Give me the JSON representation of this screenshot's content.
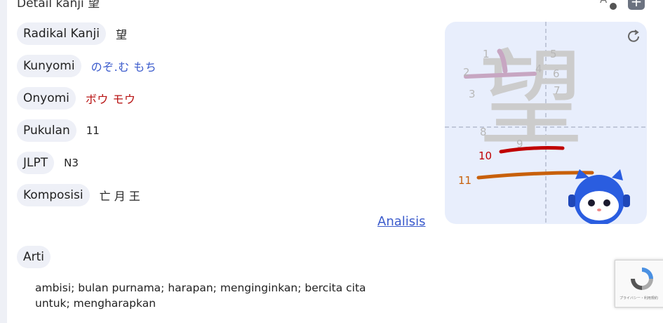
{
  "section": {
    "title": "Detail kanji 望"
  },
  "fields": {
    "radikal": {
      "label": "Radikal Kanji",
      "value": "望"
    },
    "kunyomi": {
      "label": "Kunyomi",
      "value": "のぞ.む  もち"
    },
    "onyomi": {
      "label": "Onyomi",
      "value": "ボウ  モウ"
    },
    "pukulan": {
      "label": "Pukulan",
      "value": "11"
    },
    "jlpt": {
      "label": "JLPT",
      "value": "N3"
    },
    "komposisi": {
      "label": "Komposisi",
      "value": "亡 月 王"
    }
  },
  "analysis_link": "Analisis",
  "meaning": {
    "label": "Arti",
    "text": "ambisi; bulan purnama; harapan; menginginkan; bercita cita untuk; mengharapkan"
  },
  "stroke_order": {
    "character": "望",
    "numbers": [
      "1",
      "2",
      "3",
      "4",
      "5",
      "6",
      "7",
      "8",
      "9",
      "10",
      "11"
    ],
    "colors": {
      "stroke_10": "#c00000",
      "stroke_11": "#c8600a",
      "ghost": "#c8c8c8",
      "done_stroke": "#c8a8c0"
    }
  },
  "recaptcha": {
    "text": "プライバシー・利用規約"
  },
  "icons": {
    "translate": "translate-icon",
    "add": "plus-icon",
    "replay": "replay-icon",
    "mascot": "robot-cat-mascot"
  }
}
